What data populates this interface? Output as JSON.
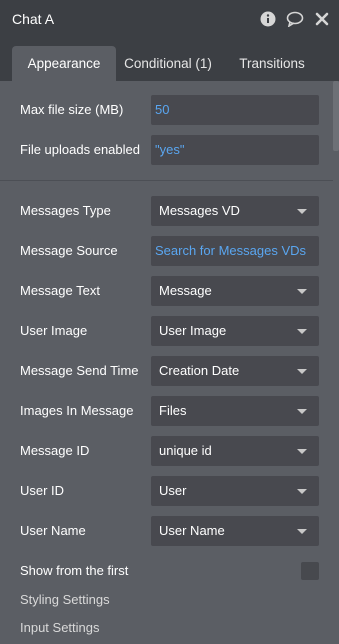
{
  "window": {
    "title": "Chat A",
    "icons": [
      "info-icon",
      "comment-icon",
      "close-icon"
    ]
  },
  "tabs": [
    {
      "label": "Appearance",
      "active": true
    },
    {
      "label": "Conditional (1)",
      "active": false
    },
    {
      "label": "Transitions",
      "active": false
    }
  ],
  "settings": {
    "max_file_size": {
      "label": "Max file size (MB)",
      "value": "50"
    },
    "file_uploads_enabled": {
      "label": "File uploads enabled",
      "value": "\"yes\""
    }
  },
  "fields": {
    "messages_type": {
      "label": "Messages Type",
      "value": "Messages VD"
    },
    "message_source": {
      "label": "Message Source",
      "value": "Search for Messages VDs"
    },
    "message_text": {
      "label": "Message Text",
      "value": "Message"
    },
    "user_image": {
      "label": "User Image",
      "value": "User Image"
    },
    "message_send_time": {
      "label": "Message Send Time",
      "value": "Creation Date"
    },
    "images_in_message": {
      "label": "Images In Message",
      "value": "Files"
    },
    "message_id": {
      "label": "Message ID",
      "value": "unique id"
    },
    "user_id": {
      "label": "User ID",
      "value": "User"
    },
    "user_name": {
      "label": "User Name",
      "value": "User Name"
    }
  },
  "show_from_first": {
    "label": "Show from the first",
    "checked": false
  },
  "sections": {
    "styling": "Styling Settings",
    "input": "Input Settings"
  },
  "colors": {
    "panel_bg": "#5b5e64",
    "header_bg": "#3c3f44",
    "field_bg": "#48494f",
    "dynamic_blue": "#5aa6f0"
  }
}
